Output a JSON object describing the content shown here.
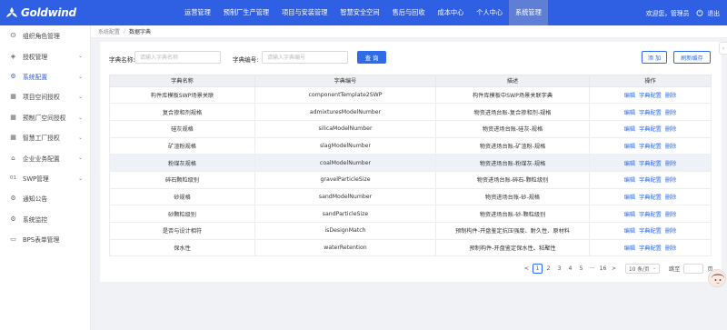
{
  "header": {
    "brand": "Goldwind",
    "nav": [
      {
        "label": "运营管理",
        "active": false
      },
      {
        "label": "预制厂生产管理",
        "active": false
      },
      {
        "label": "项目与安装管理",
        "active": false
      },
      {
        "label": "智慧安全空间",
        "active": false
      },
      {
        "label": "售后与回收",
        "active": false
      },
      {
        "label": "成本中心",
        "active": false
      },
      {
        "label": "个人中心",
        "active": false
      },
      {
        "label": "系统管理",
        "active": true
      }
    ],
    "greeting": "欢迎您，管理员",
    "logout": "退出",
    "colors": {
      "bar": "#2f5fe3",
      "active_tab": "#5f7fd6"
    }
  },
  "sidebar": {
    "items": [
      {
        "label": "组织角色管理",
        "icon": "org-icon",
        "chevron": false,
        "active": false
      },
      {
        "label": "授权管理",
        "icon": "shield-check-icon",
        "chevron": true,
        "active": false
      },
      {
        "label": "系统配置",
        "icon": "gear-icon",
        "chevron": true,
        "active": true
      },
      {
        "label": "项目空间授权",
        "icon": "grid-icon",
        "chevron": true,
        "active": false
      },
      {
        "label": "预制厂空间授权",
        "icon": "grid-icon",
        "chevron": true,
        "active": false
      },
      {
        "label": "智慧工厂授权",
        "icon": "grid-icon",
        "chevron": true,
        "active": false
      },
      {
        "label": "企业业务配置",
        "icon": "building-icon",
        "chevron": true,
        "active": false
      },
      {
        "label": "SWP管理",
        "icon": "swp-icon",
        "chevron": true,
        "active": false
      },
      {
        "label": "通知公告",
        "icon": "gear-icon",
        "chevron": false,
        "active": false
      },
      {
        "label": "系统监控",
        "icon": "gear-icon",
        "chevron": false,
        "active": false
      },
      {
        "label": "BPS表单管理",
        "icon": "monitor-icon",
        "chevron": false,
        "active": false
      }
    ]
  },
  "breadcrumb": {
    "parent": "系统配置",
    "separator": "/",
    "current": "数据字典"
  },
  "search": {
    "name_label": "字典名称:",
    "name_placeholder": "请输入字典名称",
    "code_label": "字典编号:",
    "code_placeholder": "请输入字典编号",
    "query_button": "查 询",
    "add_button": "添 加",
    "refresh_button": "刷新缓存"
  },
  "table": {
    "columns": [
      "字典名称",
      "字典编号",
      "描述",
      "操作"
    ],
    "operations": [
      "编辑",
      "字典配置",
      "删除"
    ],
    "rows": [
      {
        "name": "构件库模板SWP场景关联",
        "code": "componentTemplate2SWP",
        "desc": "构件库模板中SWP场景关联字典"
      },
      {
        "name": "复合掺和剂规格",
        "code": "admixturesModelNumber",
        "desc": "物资进场台账-复合掺和剂-规格"
      },
      {
        "name": "硅灰规格",
        "code": "silicaModelNumber",
        "desc": "物资进场台账-硅灰-规格"
      },
      {
        "name": "矿渣粉规格",
        "code": "slagModelNumber",
        "desc": "物资进场台账-矿渣粉-规格"
      },
      {
        "name": "粉煤灰规格",
        "code": "coalModelNumber",
        "desc": "物资进场台账-粉煤灰-规格"
      },
      {
        "name": "碎石颗粒级别",
        "code": "gravelParticleSize",
        "desc": "物资进场台账-碎石-颗粒级别"
      },
      {
        "name": "砂规格",
        "code": "sandModelNumber",
        "desc": "物资进场台账-砂-规格"
      },
      {
        "name": "砂颗粒级别",
        "code": "sandParticleSize",
        "desc": "物资进场台账-砂-颗粒级别"
      },
      {
        "name": "是否与设计相符",
        "code": "isDesignMatch",
        "desc": "预制构件-开盘鉴定抗压强度、耐久性、原材料"
      },
      {
        "name": "保水性",
        "code": "waterRetention",
        "desc": "预制构件-开盘鉴定保水性、粘聚性"
      }
    ],
    "highlighted_row": 4
  },
  "pagination": {
    "prev": "<",
    "pages": [
      "1",
      "2",
      "3",
      "4",
      "5",
      "···",
      "16"
    ],
    "current": "1",
    "next": ">",
    "page_size": "10 条/页",
    "jump_label": "跳至",
    "jump_suffix": "页"
  },
  "float_tab_icon": "chevron-left-icon"
}
